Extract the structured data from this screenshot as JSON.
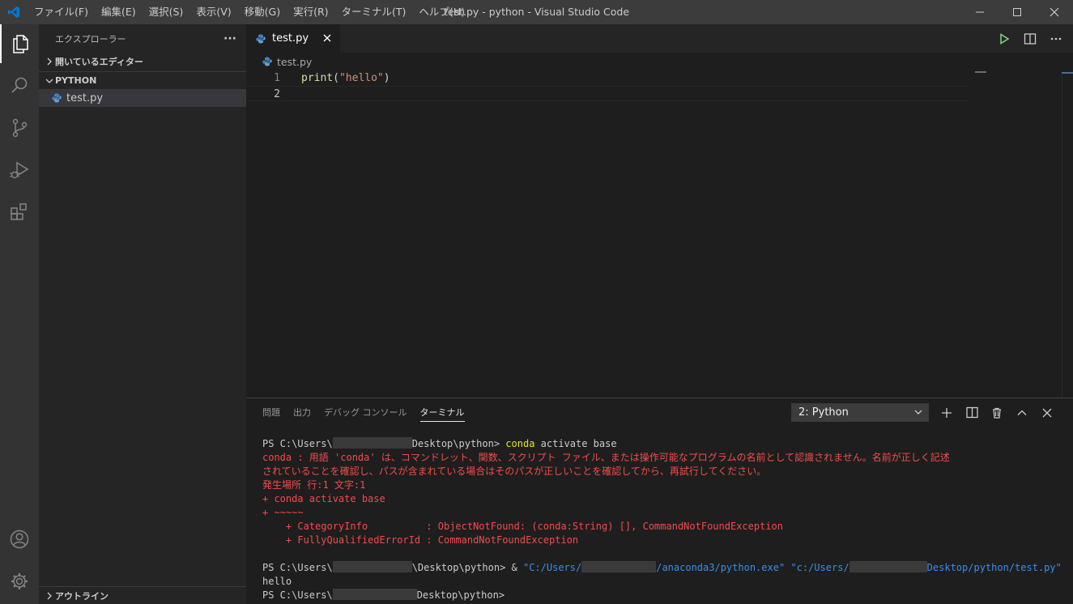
{
  "window": {
    "title": "test.py - python - Visual Studio Code",
    "menu": [
      "ファイル(F)",
      "編集(E)",
      "選択(S)",
      "表示(V)",
      "移動(G)",
      "実行(R)",
      "ターミナル(T)",
      "ヘルプ(H)"
    ]
  },
  "sidebar": {
    "header": "エクスプローラー",
    "more": "···",
    "open_editors": "開いているエディター",
    "folder": "PYTHON",
    "file": "test.py",
    "outline": "アウトライン"
  },
  "editor": {
    "tab_label": "test.py",
    "breadcrumb": "test.py",
    "lines": [
      {
        "num": "1",
        "fn": "print",
        "open": "(",
        "str": "\"hello\"",
        "close": ")"
      },
      {
        "num": "2"
      }
    ]
  },
  "panel": {
    "tabs": [
      "問題",
      "出力",
      "デバッグ コンソール",
      "ターミナル"
    ],
    "terminal_selector": "2: Python",
    "terminal": {
      "l1_prompt": "PS C:\\Users\\",
      "l1_rest": "Desktop\\python> ",
      "l1_cmd": "conda",
      "l1_args": " activate base",
      "err1": "conda : 用語 'conda' は、コマンドレット、関数、スクリプト ファイル、または操作可能なプログラムの名前として認識されません。名前が正しく記述",
      "err2": "されていることを確認し、パスが含まれている場合はそのパスが正しいことを確認してから、再試行してください。",
      "err3": "発生場所 行:1 文字:1",
      "err4": "+ conda activate base",
      "err5": "+ ~~~~~",
      "err6": "    + CategoryInfo          : ObjectNotFound: (conda:String) [], CommandNotFoundException",
      "err7": "    + FullyQualifiedErrorId : CommandNotFoundException",
      "l2_prompt": "PS C:\\Users\\",
      "l2_rest": "\\Desktop\\python> & ",
      "l2_str1a": "\"C:/Users/",
      "l2_str1b": "/anaconda3/python.exe\"",
      "l2_space": " ",
      "l2_str2a": "\"c:/Users/",
      "l2_str2b": "Desktop/python/test.py\"",
      "output": "hello",
      "l3_prompt": "PS C:\\Users\\",
      "l3_rest": "Desktop\\python>"
    }
  },
  "colors": {
    "activity_bar": "#333333",
    "sidebar": "#252526",
    "editor": "#1e1e1e",
    "error_text": "#f14c4c",
    "command": "#e5e510",
    "path_string": "#3b8eea",
    "run_button": "#89d185",
    "vscode_logo": "#0078d4"
  }
}
